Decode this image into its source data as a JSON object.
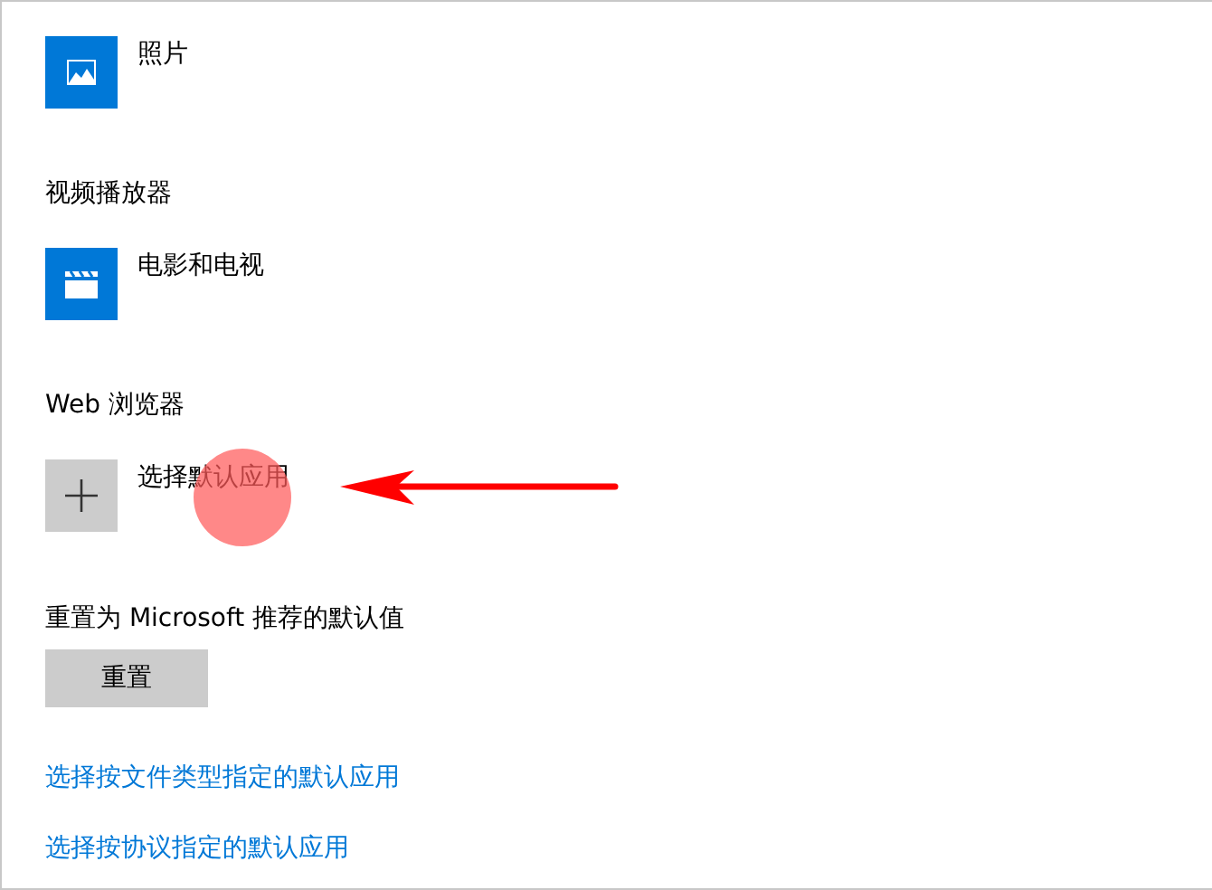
{
  "sections": [
    {
      "app": {
        "kind": "photos",
        "name": "照片"
      }
    },
    {
      "heading": "视频播放器",
      "app": {
        "kind": "movies",
        "name": "电影和电视"
      }
    },
    {
      "heading": "Web 浏览器",
      "app": {
        "kind": "choose",
        "name": "选择默认应用"
      }
    }
  ],
  "reset": {
    "label": "重置为 Microsoft 推荐的默认值",
    "button": "重置"
  },
  "links": [
    "选择按文件类型指定的默认应用",
    "选择按协议指定的默认应用"
  ]
}
